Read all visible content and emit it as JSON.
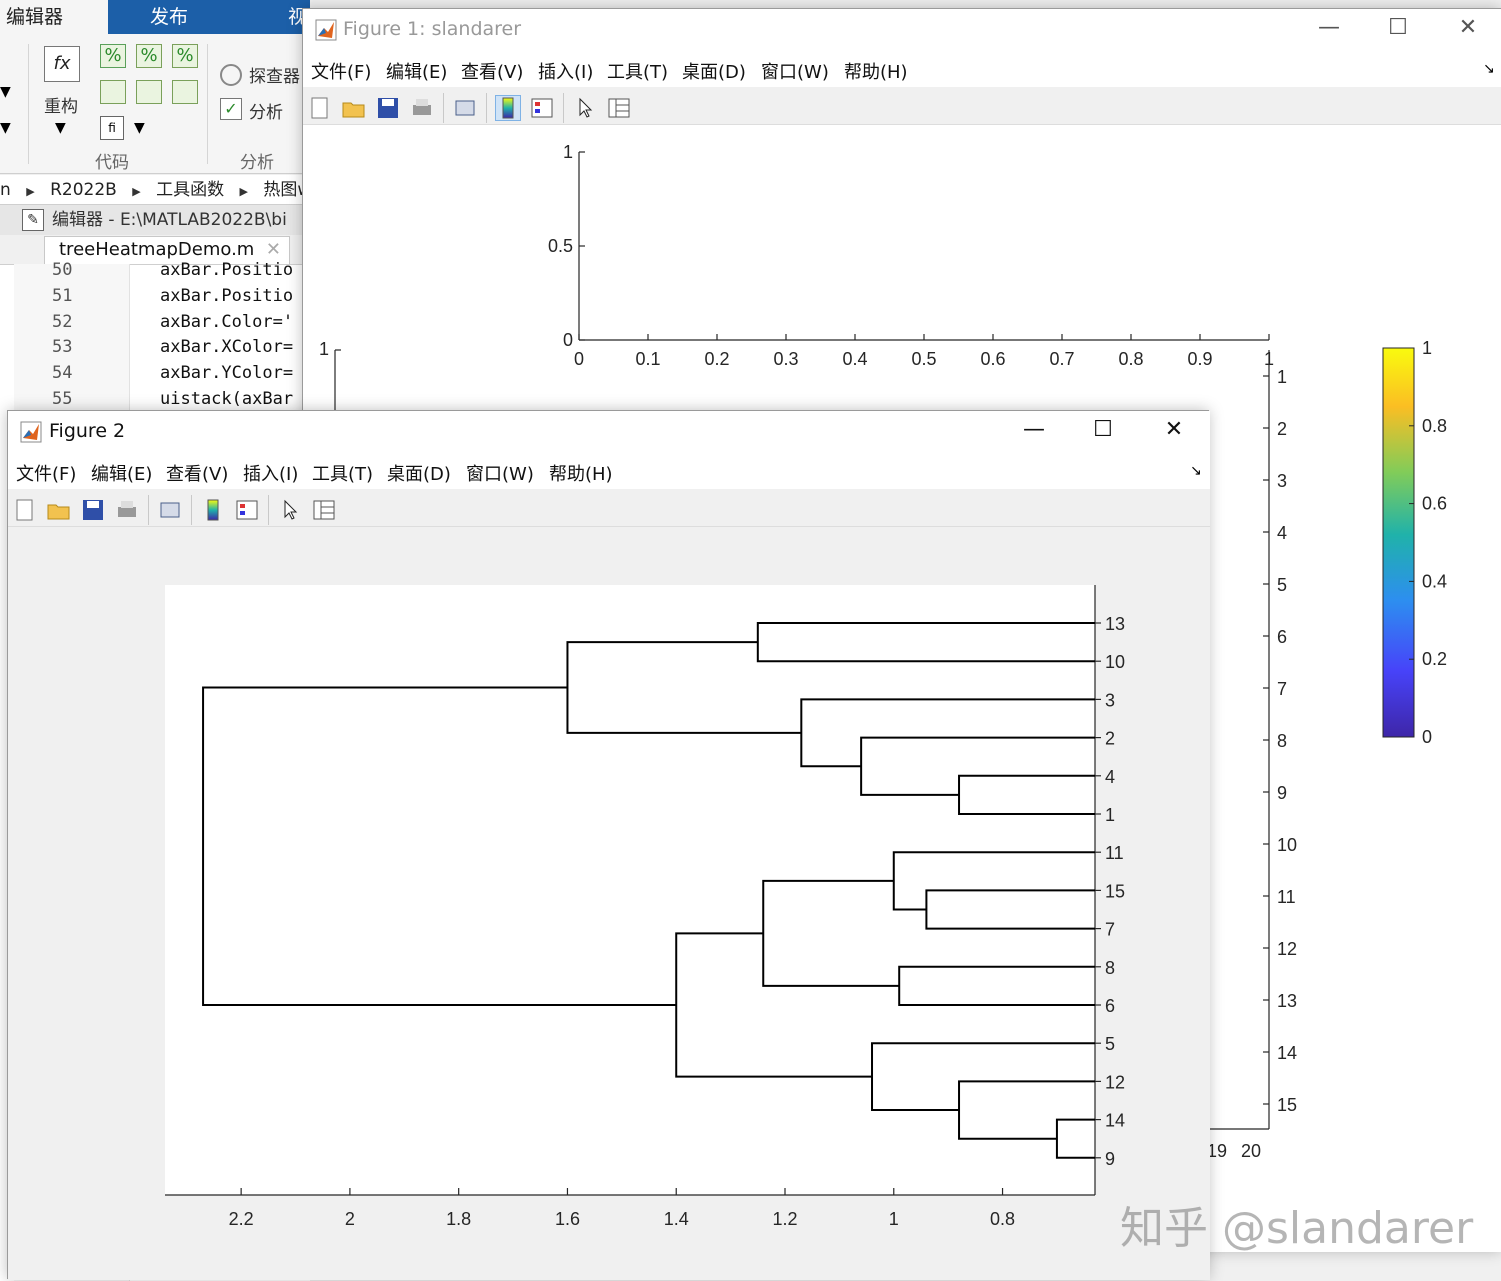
{
  "matlab": {
    "tabs": {
      "editor": "编辑器",
      "publish": "发布",
      "view": "视"
    },
    "ribbon": {
      "refactor_label": "重构",
      "explorer_label": "探查器",
      "analyze_label": "分析",
      "group_code": "代码",
      "group_analyze": "分析"
    },
    "breadcrumb": [
      "n",
      "R2022B",
      "工具函数",
      "热图wit"
    ],
    "editor_title": "编辑器 - E:\\MATLAB2022B\\bi",
    "editor_tab": "treeHeatmapDemo.m",
    "code_lines": [
      {
        "no": "50",
        "text": "axBar.Positio"
      },
      {
        "no": "51",
        "text": "axBar.Positio"
      },
      {
        "no": "52",
        "text": "axBar.Color='"
      },
      {
        "no": "53",
        "text": "axBar.XColor="
      },
      {
        "no": "54",
        "text": "axBar.YColor="
      },
      {
        "no": "55",
        "text": "uistack(axBar"
      }
    ]
  },
  "figure1": {
    "title": "Figure 1: slandarer",
    "menus": [
      "文件(F)",
      "编辑(E)",
      "查看(V)",
      "插入(I)",
      "工具(T)",
      "桌面(D)",
      "窗口(W)",
      "帮助(H)"
    ],
    "top_axis": {
      "x_ticks": [
        "0",
        "0.1",
        "0.2",
        "0.3",
        "0.4",
        "0.5",
        "0.6",
        "0.7",
        "0.8",
        "0.9",
        "1"
      ],
      "y_ticks": [
        "0",
        "0.5",
        "1"
      ]
    },
    "left_axis_tick": "1",
    "right_axis_ticks": [
      "1",
      "2",
      "3",
      "4",
      "5",
      "6",
      "7",
      "8",
      "9",
      "10",
      "11",
      "12",
      "13",
      "14",
      "15"
    ],
    "bottom_partial_ticks": [
      "19",
      "20"
    ],
    "colorbar": {
      "ticks": [
        "0",
        "0.2",
        "0.4",
        "0.6",
        "0.8",
        "1"
      ],
      "colors": [
        "#3e26a8",
        "#4743f9",
        "#2d8ef0",
        "#20b2aa",
        "#81cc59",
        "#fbbe23",
        "#f9fb0e"
      ]
    }
  },
  "figure2": {
    "title": "Figure 2",
    "menus": [
      "文件(F)",
      "编辑(E)",
      "查看(V)",
      "插入(I)",
      "工具(T)",
      "桌面(D)",
      "窗口(W)",
      "帮助(H)"
    ]
  },
  "chart_data": {
    "type": "dendrogram",
    "orientation": "left",
    "leaf_order": [
      "13",
      "10",
      "3",
      "2",
      "4",
      "1",
      "11",
      "15",
      "7",
      "8",
      "6",
      "5",
      "12",
      "14",
      "9"
    ],
    "x_ticks": [
      "2.2",
      "2",
      "1.8",
      "1.6",
      "1.4",
      "1.2",
      "1",
      "0.8"
    ],
    "xlim": [
      2.34,
      0.63
    ],
    "links": [
      {
        "a": "14",
        "b": "9",
        "height": 0.7
      },
      {
        "a": "4",
        "b": "1",
        "height": 0.88
      },
      {
        "a": "15",
        "b": "7",
        "height": 0.94
      },
      {
        "a": "12",
        "b": "14+9",
        "height": 0.88
      },
      {
        "a": "8",
        "b": "6",
        "height": 0.99
      },
      {
        "a": "11",
        "b": "15+7",
        "height": 1.0
      },
      {
        "a": "2",
        "b": "4+1",
        "height": 1.06
      },
      {
        "a": "5",
        "b": "12+14+9",
        "height": 1.04
      },
      {
        "a": "3",
        "b": "2+4+1",
        "height": 1.17
      },
      {
        "a": "11+15+7",
        "b": "8+6",
        "height": 1.24
      },
      {
        "a": "13",
        "b": "10",
        "height": 1.25
      },
      {
        "a": "13+10",
        "b": "3+2+4+1",
        "height": 1.6
      },
      {
        "a": "11+15+7+8+6",
        "b": "5+12+14+9",
        "height": 1.4
      },
      {
        "a": "top",
        "b": "bottom",
        "height": 2.27
      }
    ]
  },
  "watermark": "知乎 @slandarer"
}
